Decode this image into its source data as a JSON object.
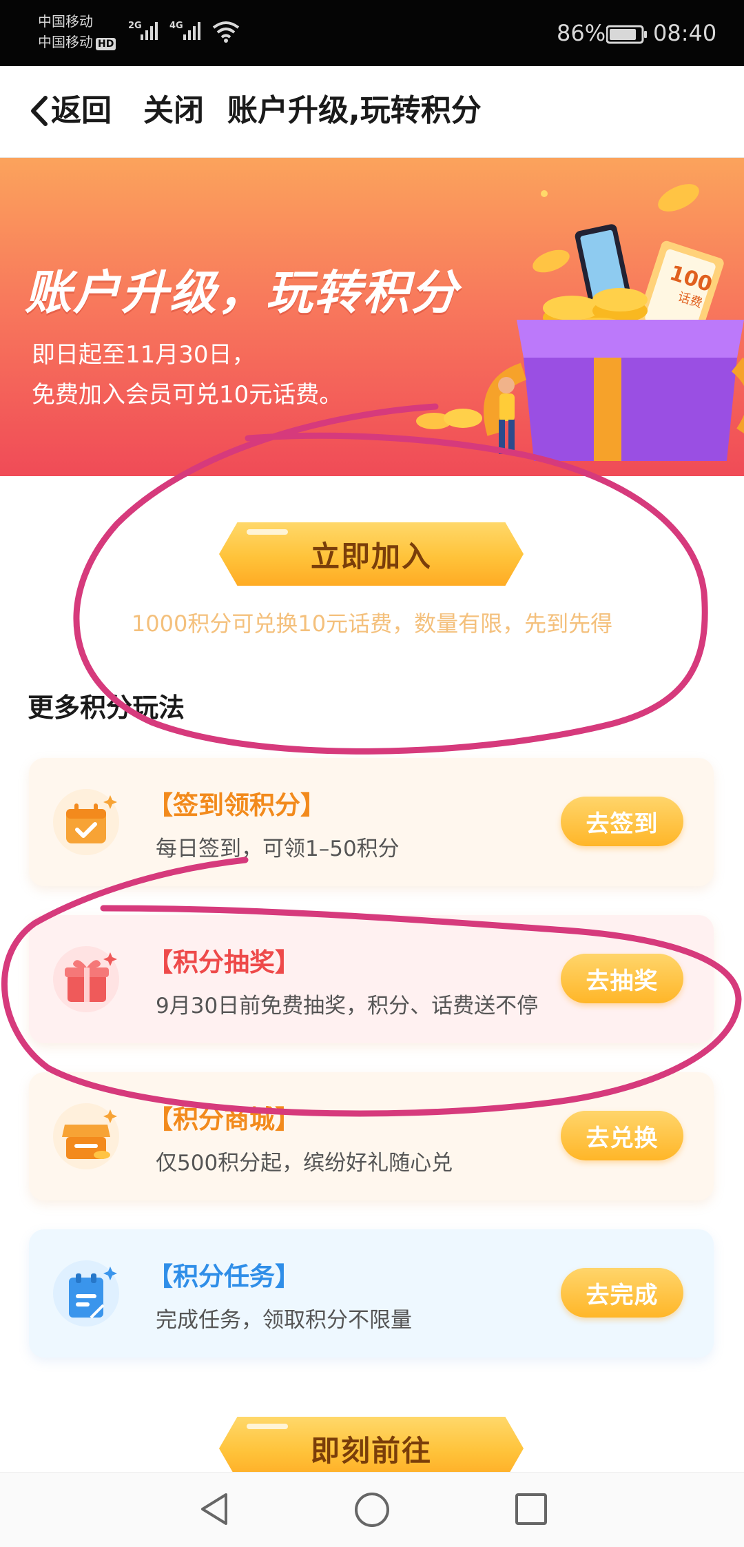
{
  "status_bar": {
    "carrier_1": "中国移动",
    "carrier_2": "中国移动",
    "hd_badge": "HD",
    "net_1": "2G",
    "net_2": "4G",
    "battery_pct": "86%",
    "battery_level": 0.86,
    "time": "08:40"
  },
  "nav": {
    "back_label": "返回",
    "close_label": "关闭",
    "title": "账户升级,玩转积分"
  },
  "banner": {
    "headline": "账户升级，玩转积分",
    "line1": "即日起至11月30日，",
    "line2": "免费加入会员可兑10元话费。",
    "voucher_amount": "100",
    "voucher_label": "话费"
  },
  "join": {
    "button_label": "立即加入",
    "note": "1000积分可兑换10元话费，数量有限，先到先得"
  },
  "more_section": {
    "title": "更多积分玩法"
  },
  "cards": [
    {
      "title": "【签到领积分】",
      "desc": "每日签到，可领1–50积分",
      "button": "去签到",
      "icon": "calendar-check-icon"
    },
    {
      "title": "【积分抽奖】",
      "desc": "9月30日前免费抽奖，积分、话费送不停",
      "button": "去抽奖",
      "icon": "gift-box-icon"
    },
    {
      "title": "【积分商城】",
      "desc": "仅500积分起，缤纷好礼随心兑",
      "button": "去兑换",
      "icon": "shop-icon"
    },
    {
      "title": "【积分任务】",
      "desc": "完成任务，领取积分不限量",
      "button": "去完成",
      "icon": "task-clipboard-icon"
    }
  ],
  "goto": {
    "button_label": "即刻前往"
  },
  "colors": {
    "accent_orange": "#f28a1c",
    "accent_red": "#ee4a4a",
    "accent_blue": "#2f8ee8",
    "annotation_magenta": "#d63a7c",
    "button_gold": "#ffc33a"
  }
}
